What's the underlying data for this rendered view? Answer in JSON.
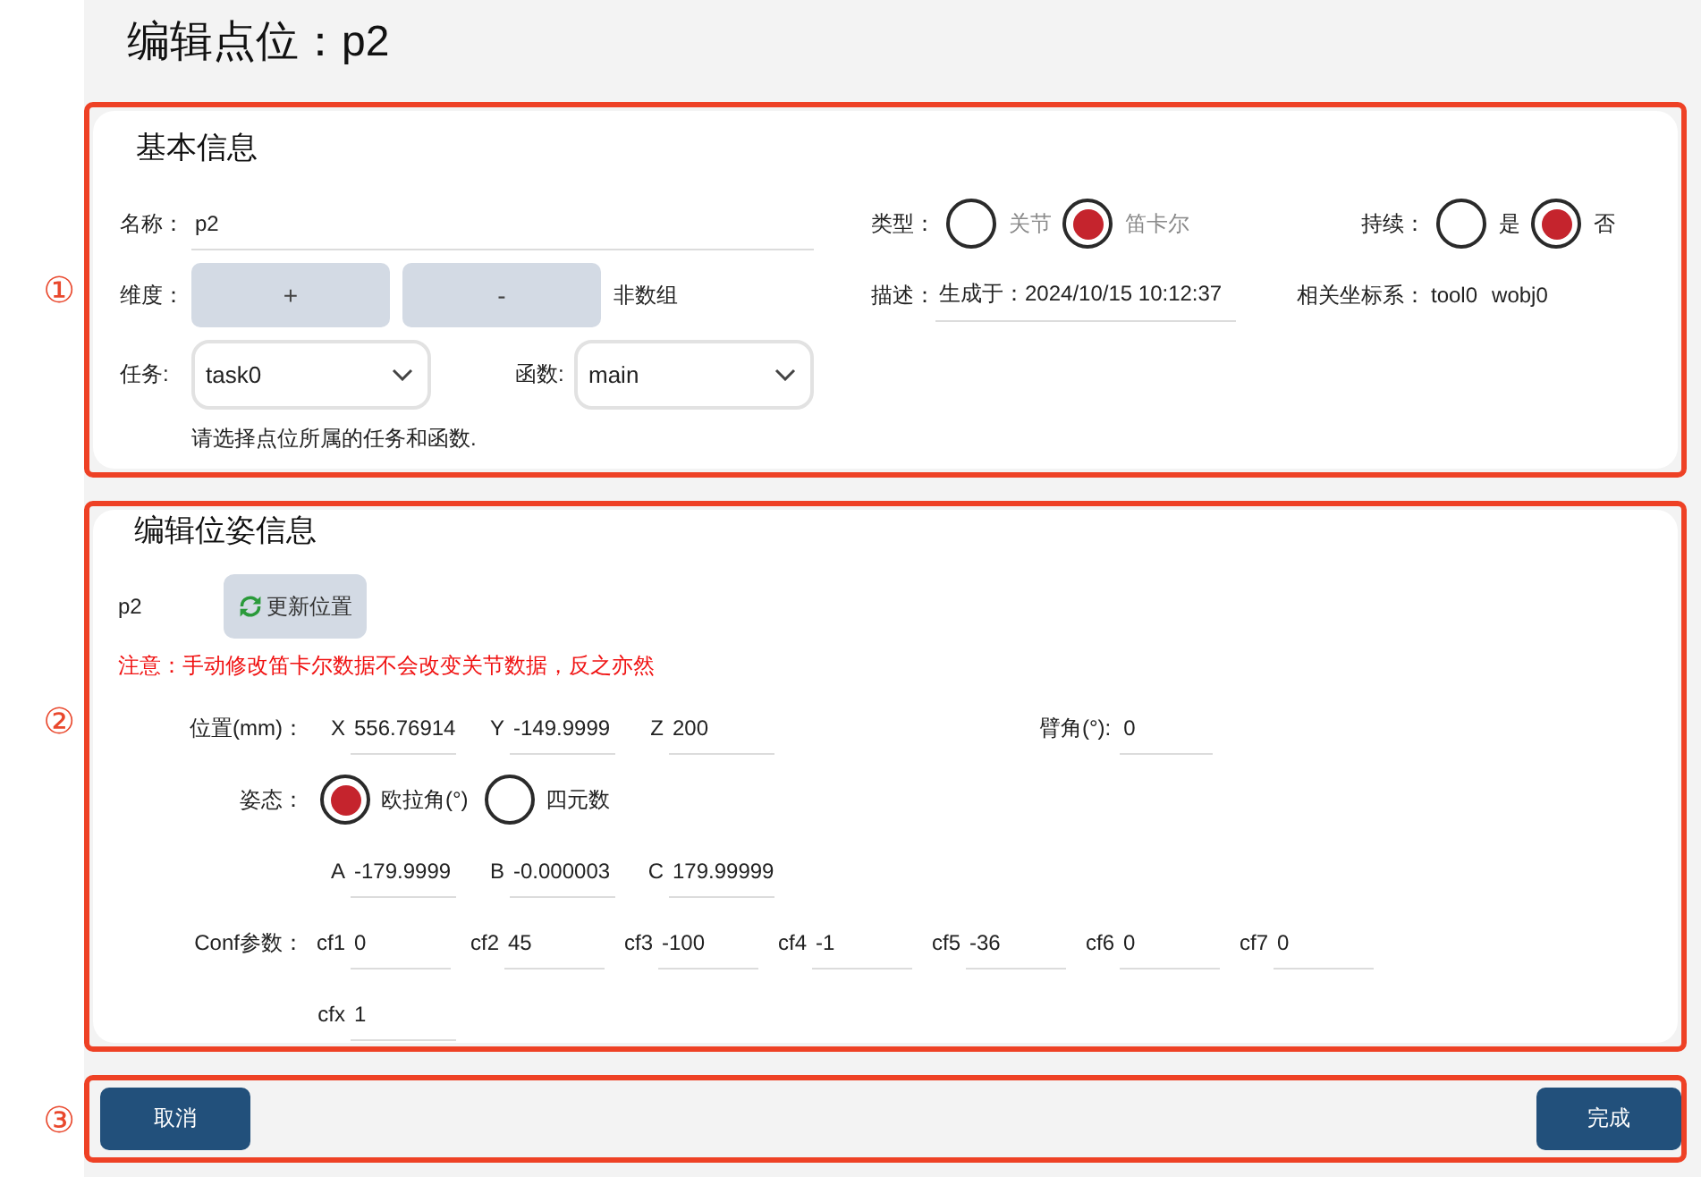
{
  "title": "编辑点位：p2",
  "basic_info": {
    "marker": "①",
    "heading": "基本信息",
    "name": {
      "label": "名称：",
      "value": "p2"
    },
    "type": {
      "label": "类型：",
      "options": [
        {
          "label": "关节",
          "selected": false,
          "disabled": true
        },
        {
          "label": "笛卡尔",
          "selected": true,
          "disabled": true
        }
      ]
    },
    "continuous": {
      "label": "持续：",
      "options": [
        {
          "label": "是",
          "selected": false,
          "disabled": false
        },
        {
          "label": "否",
          "selected": true,
          "disabled": false
        }
      ]
    },
    "dimension": {
      "label": "维度：",
      "buttons": [
        "+",
        "-"
      ],
      "note": "非数组"
    },
    "description": {
      "label": "描述：",
      "value": "生成于：2024/10/15 10:12:37"
    },
    "frames": {
      "label": "相关坐标系：",
      "values": [
        "tool0",
        "wobj0"
      ]
    },
    "task": {
      "label": "任务:",
      "value": "task0"
    },
    "function": {
      "label": "函数:",
      "value": "main"
    },
    "hint": "请选择点位所属的任务和函数."
  },
  "pose": {
    "marker": "②",
    "heading": "编辑位姿信息",
    "point_name": "p2",
    "refresh_button": "更新位置",
    "warning": "注意：手动修改笛卡尔数据不会改变关节数据，反之亦然",
    "position": {
      "label": "位置(mm)：",
      "fields": [
        {
          "key": "X",
          "value": "556.76914"
        },
        {
          "key": "Y",
          "value": "-149.9999"
        },
        {
          "key": "Z",
          "value": "200"
        }
      ]
    },
    "arm_angle": {
      "label": "臂角(°):",
      "value": "0"
    },
    "orientation": {
      "label": "姿态：",
      "options": [
        {
          "label": "欧拉角(°)",
          "selected": true,
          "disabled": false
        },
        {
          "label": "四元数",
          "selected": false,
          "disabled": false
        }
      ]
    },
    "euler": {
      "fields": [
        {
          "key": "A",
          "value": "-179.9999"
        },
        {
          "key": "B",
          "value": "-0.000003"
        },
        {
          "key": "C",
          "value": "179.99999"
        }
      ]
    },
    "conf": {
      "label": "Conf参数：",
      "fields": [
        {
          "key": "cf1",
          "value": "0"
        },
        {
          "key": "cf2",
          "value": "45"
        },
        {
          "key": "cf3",
          "value": "-100"
        },
        {
          "key": "cf4",
          "value": "-1"
        },
        {
          "key": "cf5",
          "value": "-36"
        },
        {
          "key": "cf6",
          "value": "0"
        },
        {
          "key": "cf7",
          "value": "0"
        }
      ]
    },
    "cfx": {
      "key": "cfx",
      "value": "1"
    }
  },
  "footer": {
    "marker": "③",
    "buttons": [
      {
        "label": "取消"
      },
      {
        "label": "完成"
      }
    ]
  }
}
